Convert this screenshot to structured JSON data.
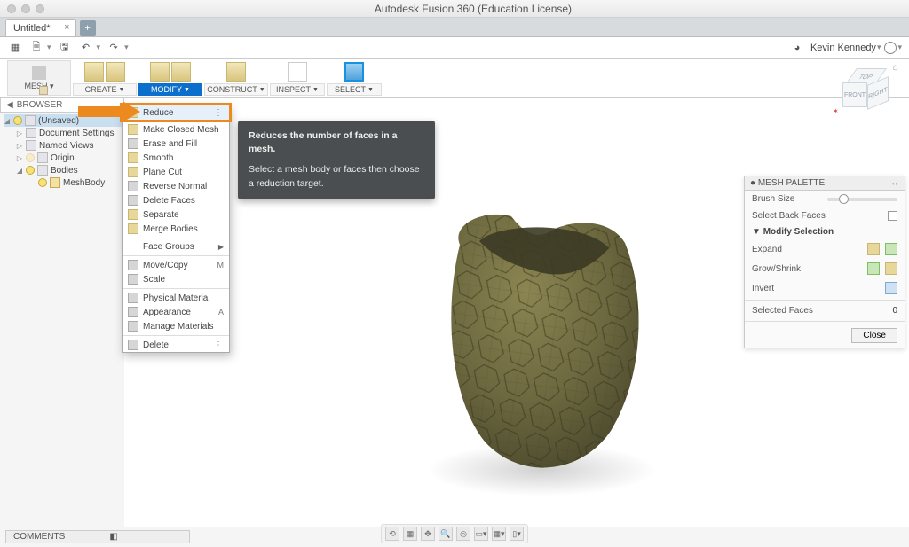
{
  "window": {
    "title": "Autodesk Fusion 360 (Education License)"
  },
  "tab": {
    "name": "Untitled*"
  },
  "user": {
    "name": "Kevin Kennedy"
  },
  "workspace": {
    "label": "MESH"
  },
  "ribbon": {
    "create": "CREATE",
    "modify": "MODIFY",
    "construct": "CONSTRUCT",
    "inspect": "INSPECT",
    "select": "SELECT"
  },
  "browser": {
    "header": "BROWSER",
    "items": [
      {
        "label": "(Unsaved)"
      },
      {
        "label": "Document Settings"
      },
      {
        "label": "Named Views"
      },
      {
        "label": "Origin"
      },
      {
        "label": "Bodies"
      },
      {
        "label": "MeshBody"
      }
    ]
  },
  "menu": {
    "reduce": "Reduce",
    "make_closed": "Make Closed Mesh",
    "erase_fill": "Erase and Fill",
    "smooth": "Smooth",
    "plane_cut": "Plane Cut",
    "reverse_normal": "Reverse Normal",
    "delete_faces": "Delete Faces",
    "separate": "Separate",
    "merge_bodies": "Merge Bodies",
    "face_groups": "Face Groups",
    "move_copy": "Move/Copy",
    "move_sc": "M",
    "scale": "Scale",
    "phys_mat": "Physical Material",
    "appearance": "Appearance",
    "appearance_sc": "A",
    "manage_mat": "Manage Materials",
    "delete": "Delete"
  },
  "tooltip": {
    "line1": "Reduces the number of faces in a mesh.",
    "line2": "Select a mesh body or faces then choose a reduction target."
  },
  "cube": {
    "top": "TOP",
    "front": "FRONT",
    "right": "RIGHT"
  },
  "palette": {
    "title": "MESH PALETTE",
    "brush": "Brush Size",
    "back_faces": "Select Back Faces",
    "section": "Modify Selection",
    "expand": "Expand",
    "grow": "Grow/Shrink",
    "invert": "Invert",
    "selected": "Selected Faces",
    "selected_val": "0",
    "close": "Close"
  },
  "comments": {
    "label": "COMMENTS"
  }
}
